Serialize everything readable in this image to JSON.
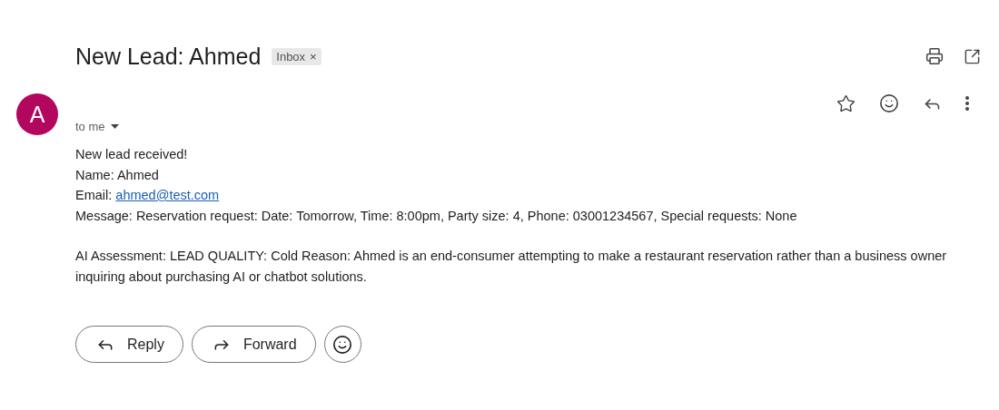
{
  "subject": "New Lead: Ahmed",
  "label": {
    "text": "Inbox",
    "close": "×"
  },
  "avatar": {
    "letter": "A"
  },
  "recipient": "to me",
  "body": [
    {
      "kind": "line",
      "text": "New lead received!"
    },
    {
      "kind": "line",
      "text": "Name: Ahmed"
    },
    {
      "kind": "link",
      "text": "Email: ",
      "link": "ahmed@test.com"
    },
    {
      "kind": "line",
      "text": "Message: Reservation request: Date: Tomorrow, Time: 8:00pm, Party size: 4, Phone: 03001234567, Special requests: None"
    },
    {
      "kind": "paragraph",
      "text": "AI Assessment: LEAD QUALITY: Cold Reason: Ahmed is an end-consumer attempting to make a restaurant reservation rather than a business owner inquiring about purchasing AI or chatbot solutions."
    }
  ],
  "buttons": [
    {
      "kind": "reply",
      "label": "Reply"
    },
    {
      "kind": "forward",
      "label": "Forward"
    },
    {
      "kind": "emoji"
    }
  ]
}
